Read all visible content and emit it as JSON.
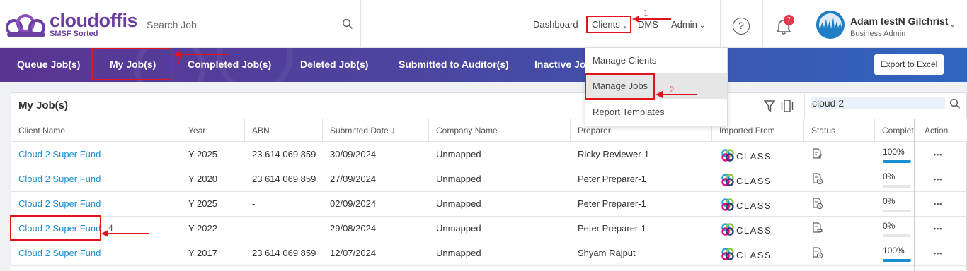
{
  "brand": {
    "name": "cloudoffis",
    "tagline": "SMSF Sorted",
    "color": "#6b3fa0"
  },
  "search": {
    "placeholder": "Search Job"
  },
  "nav": {
    "dashboard": "Dashboard",
    "clients": "Clients",
    "dms": "DMS",
    "admin": "Admin"
  },
  "notifications": {
    "count": "7"
  },
  "user": {
    "name": "Adam testN Gilchrist",
    "role": "Business Admin"
  },
  "tabs": [
    "Queue Job(s)",
    "My Job(s)",
    "Completed Job(s)",
    "Deleted Job(s)",
    "Submitted to Auditor(s)",
    "Inactive Job"
  ],
  "export_label": "Export to Excel",
  "dropdown": {
    "items": [
      "Manage Clients",
      "Manage Jobs",
      "Report Templates"
    ]
  },
  "panel": {
    "title": "My Job(s)",
    "search_value": "cloud 2"
  },
  "columns": [
    "Client Name",
    "Year",
    "ABN",
    "Submitted Date",
    "Company Name",
    "Preparer",
    "Imported From",
    "Status",
    "Complet",
    "Action"
  ],
  "rows": [
    {
      "client": "Cloud 2 Super Fund",
      "year": "Y 2025",
      "abn": "23 614 069 859",
      "date": "30/09/2024",
      "company": "Unmapped",
      "preparer": "Ricky Reviewer-1",
      "imported": "CLASS",
      "status_icon": "document-edit-icon",
      "complete": "100%",
      "complete_value": 1.0
    },
    {
      "client": "Cloud 2 Super Fund",
      "year": "Y 2020",
      "abn": "23 614 069 859",
      "date": "27/09/2024",
      "company": "Unmapped",
      "preparer": "Peter Preparer-1",
      "imported": "CLASS",
      "status_icon": "document-clock-icon",
      "complete": "0%",
      "complete_value": 0.0
    },
    {
      "client": "Cloud 2 Super Fund",
      "year": "Y 2025",
      "abn": "-",
      "date": "02/09/2024",
      "company": "Unmapped",
      "preparer": "Peter Preparer-1",
      "imported": "CLASS",
      "status_icon": "document-clock-icon",
      "complete": "0%",
      "complete_value": 0.0
    },
    {
      "client": "Cloud 2 Super Fund",
      "year": "Y 2022",
      "abn": "-",
      "date": "29/08/2024",
      "company": "Unmapped",
      "preparer": "Peter Preparer-1",
      "imported": "CLASS",
      "status_icon": "document-chat-icon",
      "complete": "0%",
      "complete_value": 0.0
    },
    {
      "client": "Cloud 2 Super Fund",
      "year": "Y 2017",
      "abn": "23 614 069 859",
      "date": "12/07/2024",
      "company": "Unmapped",
      "preparer": "Shyam Rajput",
      "imported": "CLASS",
      "status_icon": "document-clock-icon",
      "complete": "100%",
      "complete_value": 1.0
    }
  ],
  "annotations": [
    "1",
    "2",
    "3",
    "4"
  ],
  "colors": {
    "accent_link": "#1a8fd0",
    "annotation_red": "#e0141e",
    "badge_red": "#e2364a"
  }
}
